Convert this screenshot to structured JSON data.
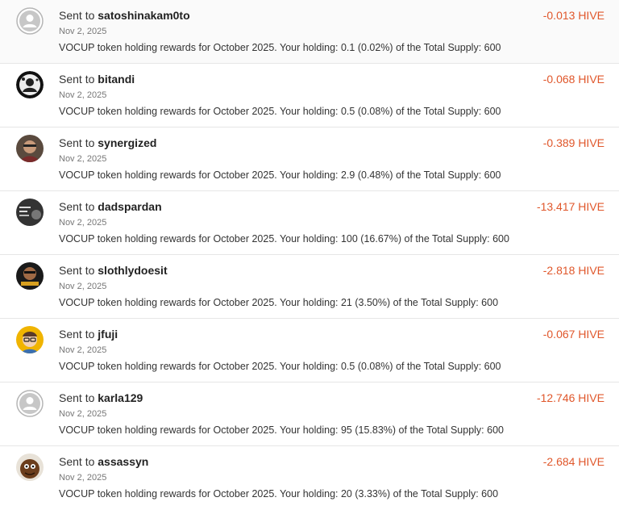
{
  "transfers": [
    {
      "prefix": "Sent to",
      "user": "satoshinakam0to",
      "date": "Nov 2, 2025",
      "memo": "VOCUP token holding rewards for October 2025. Your holding: 0.1 (0.02%) of the Total Supply: 600",
      "amount": "-0.013 HIVE",
      "avatar_icon": "default-user-avatar"
    },
    {
      "prefix": "Sent to",
      "user": "bitandi",
      "date": "Nov 2, 2025",
      "memo": "VOCUP token holding rewards for October 2025. Your holding: 0.5 (0.08%) of the Total Supply: 600",
      "amount": "-0.068 HIVE",
      "avatar_icon": "user-avatar"
    },
    {
      "prefix": "Sent to",
      "user": "synergized",
      "date": "Nov 2, 2025",
      "memo": "VOCUP token holding rewards for October 2025. Your holding: 2.9 (0.48%) of the Total Supply: 600",
      "amount": "-0.389 HIVE",
      "avatar_icon": "user-avatar"
    },
    {
      "prefix": "Sent to",
      "user": "dadspardan",
      "date": "Nov 2, 2025",
      "memo": "VOCUP token holding rewards for October 2025. Your holding: 100 (16.67%) of the Total Supply: 600",
      "amount": "-13.417 HIVE",
      "avatar_icon": "user-avatar"
    },
    {
      "prefix": "Sent to",
      "user": "slothlydoesit",
      "date": "Nov 2, 2025",
      "memo": "VOCUP token holding rewards for October 2025. Your holding: 21 (3.50%) of the Total Supply: 600",
      "amount": "-2.818 HIVE",
      "avatar_icon": "user-avatar"
    },
    {
      "prefix": "Sent to",
      "user": "jfuji",
      "date": "Nov 2, 2025",
      "memo": "VOCUP token holding rewards for October 2025. Your holding: 0.5 (0.08%) of the Total Supply: 600",
      "amount": "-0.067 HIVE",
      "avatar_icon": "user-avatar"
    },
    {
      "prefix": "Sent to",
      "user": "karla129",
      "date": "Nov 2, 2025",
      "memo": "VOCUP token holding rewards for October 2025. Your holding: 95 (15.83%) of the Total Supply: 600",
      "amount": "-12.746 HIVE",
      "avatar_icon": "default-user-avatar"
    },
    {
      "prefix": "Sent to",
      "user": "assassyn",
      "date": "Nov 2, 2025",
      "memo": "VOCUP token holding rewards for October 2025. Your holding: 20 (3.33%) of the Total Supply: 600",
      "amount": "-2.684 HIVE",
      "avatar_icon": "user-avatar"
    }
  ],
  "colors": {
    "amount": "#e0572b",
    "divider": "#e6e6e6"
  }
}
